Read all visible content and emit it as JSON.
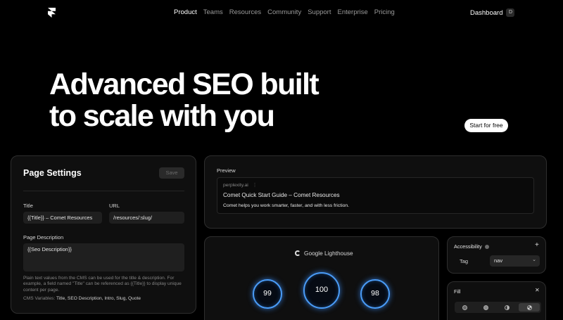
{
  "nav": {
    "links": [
      "Product",
      "Teams",
      "Resources",
      "Community",
      "Support",
      "Enterprise",
      "Pricing"
    ],
    "active_link": "Product",
    "dashboard_label": "Dashboard",
    "avatar_letter": "D"
  },
  "hero": {
    "line1": "Advanced SEO built",
    "line2": "to scale with you",
    "cta_label": "Start for free"
  },
  "page_settings": {
    "title": "Page Settings",
    "save_label": "Save",
    "title_label": "Title",
    "title_value": "{{Title}} – Comet Resources",
    "url_label": "URL",
    "url_value": "/resources/:slug/",
    "description_label": "Page Description",
    "description_value": "{{Seo Description}}",
    "hint": "Plain text values from the CMS can be used for the title & description. For example, a field named \"Title\" can be referenced as {{Title}} to display unique content per page.",
    "cms_vars_label": "CMS Variables:",
    "cms_vars_value": "Title, SEO Description, Intro, Slug, Quote"
  },
  "preview": {
    "label": "Preview",
    "site": "perplexity.ai",
    "page_title": "Comet Quick Start Guide – Comet Resources",
    "description": "Comet helps you work smarter, faster, and with less friction."
  },
  "lighthouse": {
    "title": "Google Lighthouse",
    "scores": [
      "99",
      "100",
      "98"
    ]
  },
  "accessibility": {
    "title": "Accessibility",
    "tag_label": "Tag",
    "tag_value": "nav"
  },
  "fill": {
    "title": "Fill"
  },
  "colors": {
    "ring": "#4a9cf7",
    "background": "#000000",
    "panel": "#0f0f0f"
  }
}
